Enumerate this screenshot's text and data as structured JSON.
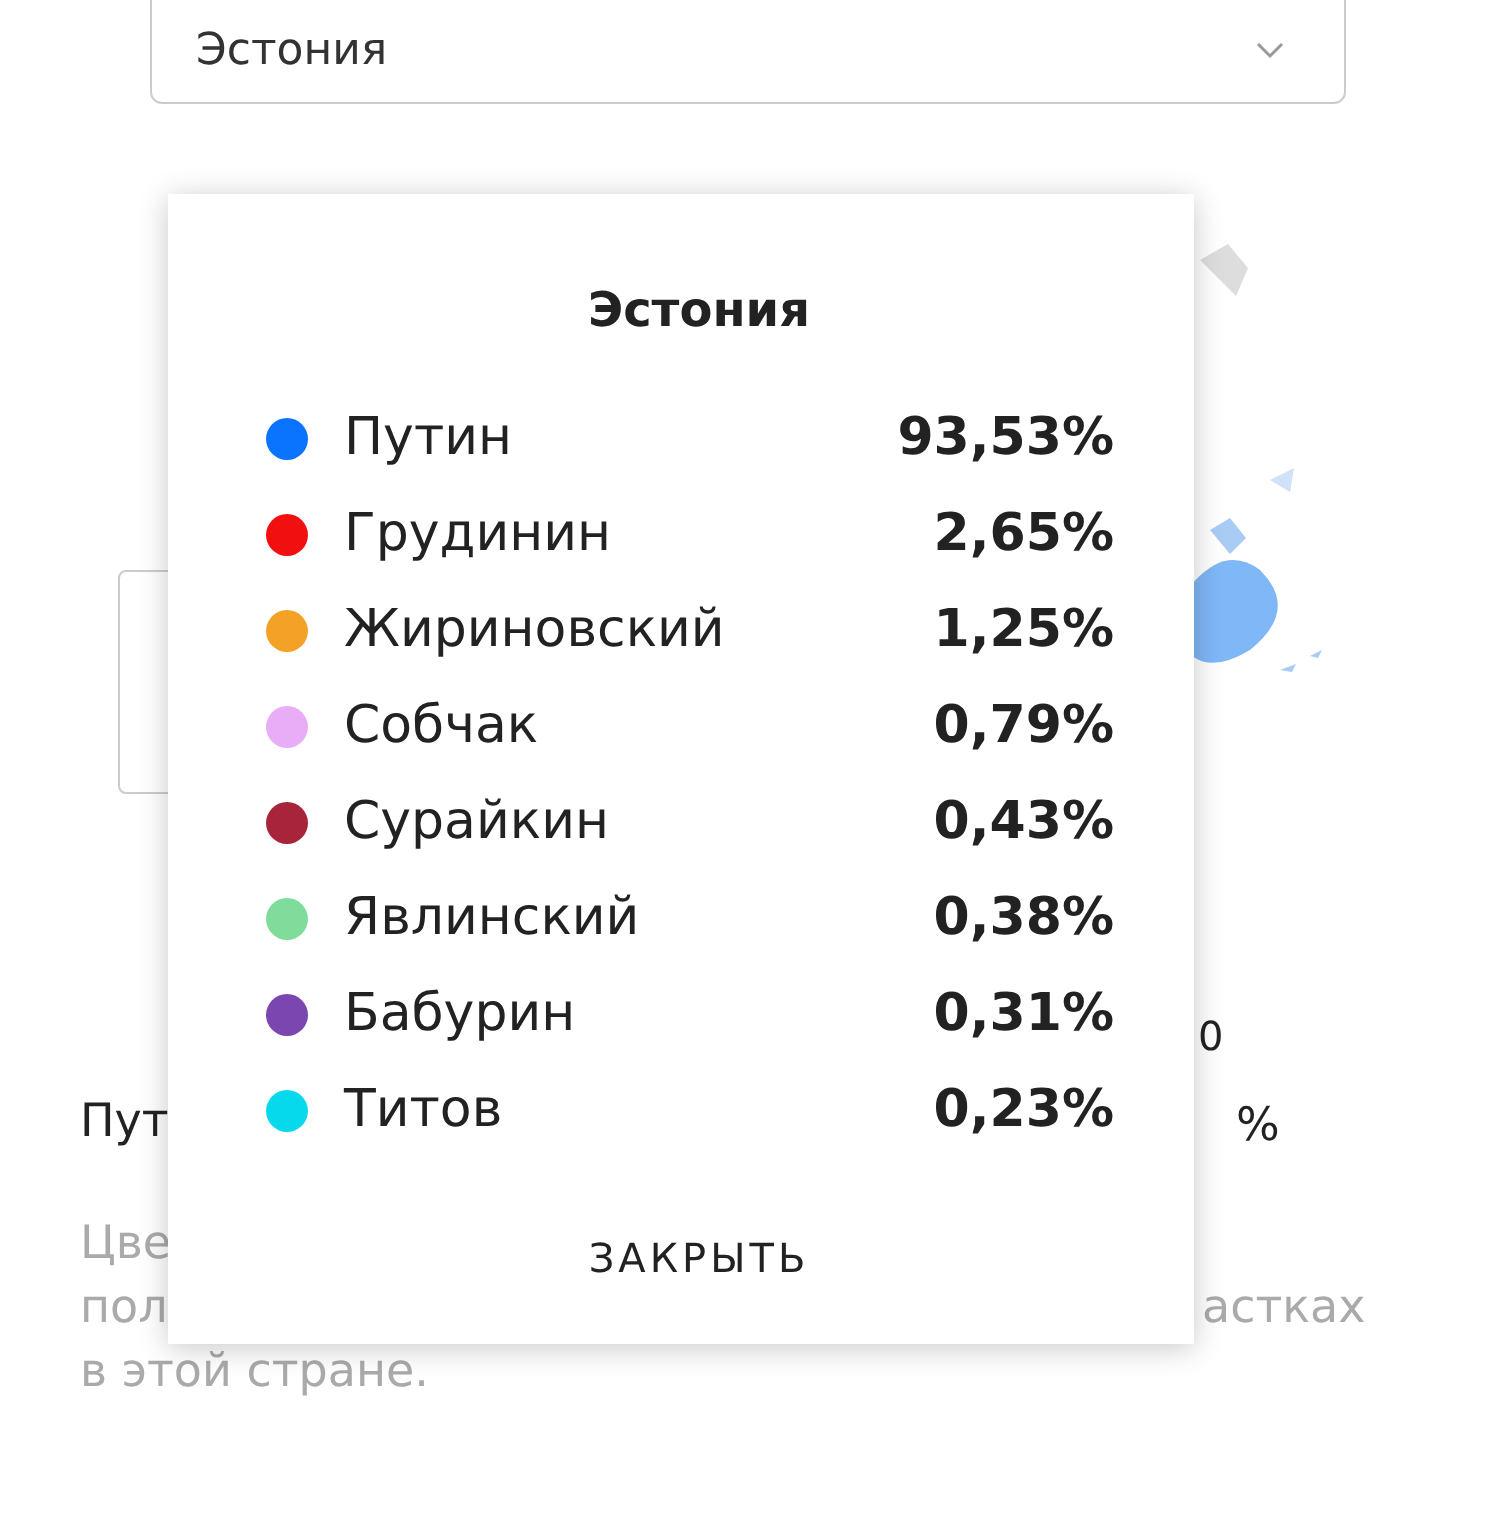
{
  "country_select": {
    "value": "Эстония"
  },
  "scale_fragment": "0",
  "summary_fragments": [
    "Пут",
    "%"
  ],
  "note_fragments": [
    "Цве",
    "пол",
    "астках",
    "в этой стране."
  ],
  "popup": {
    "title": "Эстония",
    "rows": [
      {
        "name": "Путин",
        "value": "93,53%",
        "color": "#0a74ff"
      },
      {
        "name": "Грудинин",
        "value": "2,65%",
        "color": "#f20f0f"
      },
      {
        "name": "Жириновский",
        "value": "1,25%",
        "color": "#f4a227"
      },
      {
        "name": "Собчак",
        "value": "0,79%",
        "color": "#e9adf7"
      },
      {
        "name": "Сурайкин",
        "value": "0,43%",
        "color": "#a8243a"
      },
      {
        "name": "Явлинский",
        "value": "0,38%",
        "color": "#7fdc9a"
      },
      {
        "name": "Бабурин",
        "value": "0,31%",
        "color": "#7b46b0"
      },
      {
        "name": "Титов",
        "value": "0,23%",
        "color": "#07d9ec"
      }
    ],
    "close_button": "ЗАКРЫТЬ"
  }
}
